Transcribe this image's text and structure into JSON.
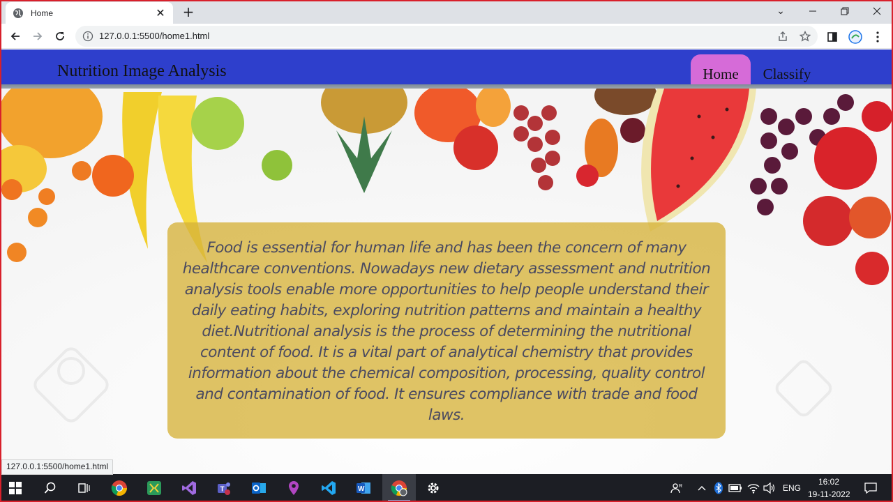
{
  "browser": {
    "tab_title": "Home",
    "url": "127.0.0.1:5500/home1.html",
    "status_url": "127.0.0.1:5500/home1.html"
  },
  "site": {
    "brand": "Nutrition Image Analysis",
    "nav": [
      {
        "label": "Home",
        "active": true
      },
      {
        "label": "Classify",
        "active": false
      }
    ],
    "description": "Food is essential for human life and has been the concern of many healthcare conventions. Nowadays new dietary assessment and nutrition analysis tools enable more opportunities to help people understand their daily eating habits, exploring nutrition patterns and maintain a healthy diet.Nutritional analysis is the process of determining the nutritional content of food. It is a vital part of analytical chemistry that provides information about the chemical composition, processing, quality control and contamination of food. It ensures compliance with trade and food laws."
  },
  "taskbar": {
    "language": "ENG",
    "time": "16:02",
    "date": "19-11-2022"
  },
  "colors": {
    "header": "#2e3fcc",
    "nav_active": "#d66bd8",
    "card": "#d6b23a"
  }
}
